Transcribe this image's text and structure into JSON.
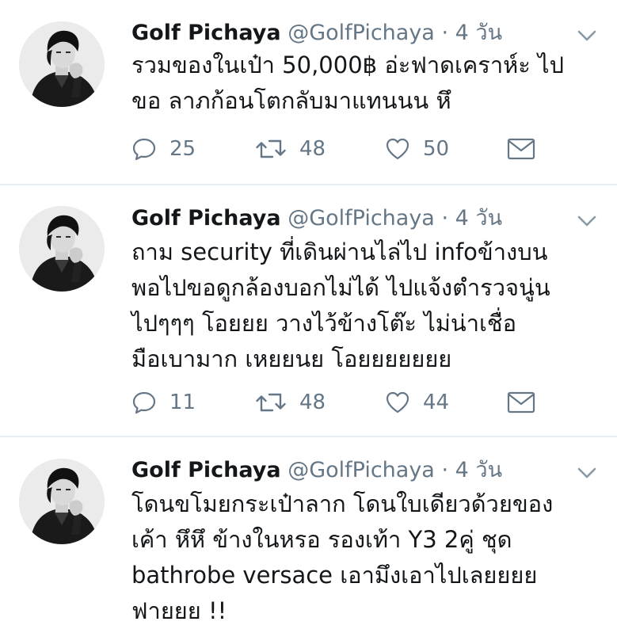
{
  "tweets": [
    {
      "name": "Golf Pichaya",
      "handle": "@GolfPichaya",
      "separator": "·",
      "time": "4 วัน",
      "lines": [
        "รวมของในเป๋า 50,000฿ อ่ะฟาดเคราห์ะ ไป",
        "ขอ ลาภก้อนโตกลับมาแทนนน หึ"
      ],
      "replies": "25",
      "retweets": "48",
      "likes": "50"
    },
    {
      "name": "Golf Pichaya",
      "handle": "@GolfPichaya",
      "separator": "·",
      "time": "4 วัน",
      "lines": [
        "ถาม security ที่เดินผ่านไล่ไป infoข้างบน",
        "พอไปขอดูกล้องบอกไม่ได้ ไปแจ้งตำรวจนู่น",
        "ไปๆๆๆ โอยยย วางไว้ข้างโต๊ะ ไม่น่าเชื่อ",
        "มือเบามาก เหยยนย โอยยยยยยย"
      ],
      "replies": "11",
      "retweets": "48",
      "likes": "44"
    },
    {
      "name": "Golf Pichaya",
      "handle": "@GolfPichaya",
      "separator": "·",
      "time": "4 วัน",
      "lines": [
        "โดนขโมยกระเป๋าลาก โดนใบเดียวด้วยของ",
        "เค้า หึหึ ข้างในหรอ รองเท้า Y3 2คู่ ชุด",
        "bathrobe versace เอามึงเอาไปเลยยยย",
        "ฟายยย !!"
      ]
    }
  ],
  "icons": {
    "reply": "reply-icon",
    "retweet": "retweet-icon",
    "like": "heart-icon",
    "dm": "mail-icon",
    "menu": "chevron-down-icon"
  },
  "colors": {
    "text": "#14171a",
    "secondary": "#657786",
    "divider": "#e6ecf0",
    "icon": "#657786"
  }
}
